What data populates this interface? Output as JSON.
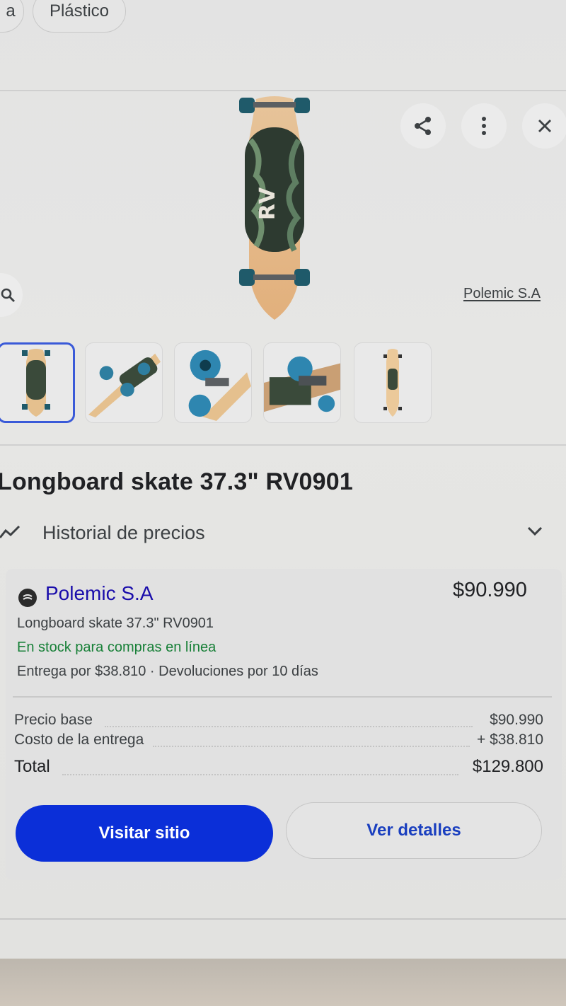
{
  "chips": [
    "a",
    "Plástico"
  ],
  "header_actions": {
    "share_icon": "share-icon",
    "more_icon": "more-vert-icon",
    "close_icon": "close-icon"
  },
  "image_source_link": "Polemic S.A",
  "thumbnails_count": 5,
  "product": {
    "title": "Longboard skate 37.3\" RV0901"
  },
  "price_history": {
    "label": "Historial de precios"
  },
  "offer": {
    "store_name": "Polemic S.A",
    "price": "$90.990",
    "product_name": "Longboard skate 37.3\" RV0901",
    "stock": "En stock para compras en línea",
    "shipping": "Entrega por $38.810 · Devoluciones por 10 días",
    "breakdown": {
      "base_label": "Precio base",
      "base_value": "$90.990",
      "delivery_label": "Costo de la entrega",
      "delivery_value": "+ $38.810",
      "total_label": "Total",
      "total_value": "$129.800"
    },
    "visit_button": "Visitar sitio",
    "details_button": "Ver detalles"
  },
  "colors": {
    "primary_button": "#0b2fd8",
    "link_blue": "#1a0dab",
    "stock_green": "#188038"
  }
}
